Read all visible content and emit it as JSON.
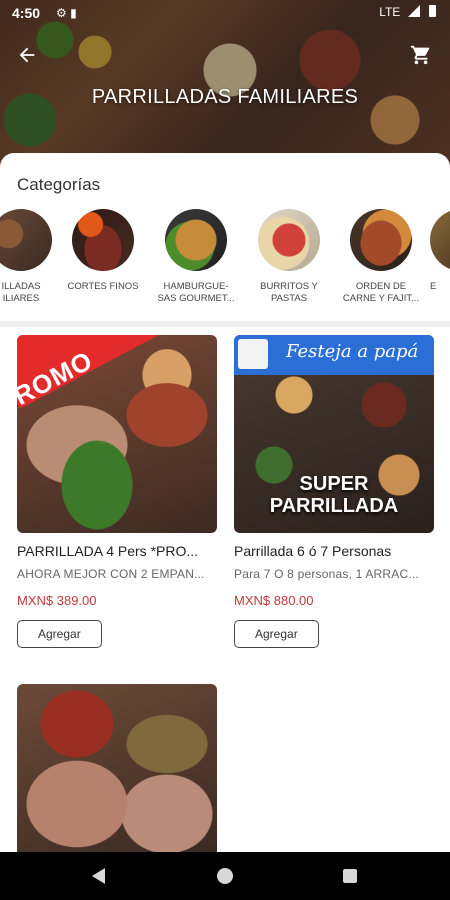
{
  "status_bar": {
    "time": "4:50",
    "network": "LTE"
  },
  "header": {
    "title": "PARRILLADAS FAMILIARES",
    "back_icon": "arrow-left-icon",
    "cart_icon": "shopping-cart-icon"
  },
  "categories": {
    "title": "Categorías",
    "items": [
      {
        "label": "ILLADAS\nILIARES",
        "selected": true
      },
      {
        "label": "CORTES FINOS"
      },
      {
        "label": "HAMBURGUE-\nSAS GOURMET..."
      },
      {
        "label": "BURRITOS Y\nPASTAS"
      },
      {
        "label": "ORDEN DE\nCARNE Y FAJIT..."
      },
      {
        "label": "E"
      }
    ]
  },
  "products": [
    {
      "name": "PARRILLADA 4 Pers *PRO...",
      "description": "AHORA MEJOR CON 2 EMPAN...",
      "price": "MXN$ 389.00",
      "button": "Agregar",
      "image_text": "ROMO"
    },
    {
      "name": "Parrillada 6 ó 7 Personas",
      "description": "Para 7 O 8 personas, 1 ARRAC...",
      "price": "MXN$ 880.00",
      "button": "Agregar",
      "image_banner": "Festeja a papá",
      "image_text": "SUPER\nPARRILLADA"
    },
    {
      "name": "",
      "description": "",
      "price": "",
      "button": ""
    }
  ],
  "colors": {
    "price": "#c0393b",
    "promo_red": "#e32b2b",
    "banner_blue": "#2a6ed6"
  }
}
